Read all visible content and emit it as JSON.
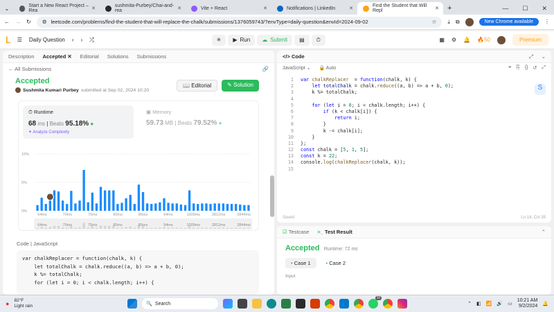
{
  "browser": {
    "tabs": [
      {
        "title": "Start a New React Project – Rea",
        "color": "#555"
      },
      {
        "title": "sushmita-Purbey/Chai-and-rea",
        "color": "#24292f"
      },
      {
        "title": "Vite + React",
        "color": "#8f5bfa"
      },
      {
        "title": "Notifications | LinkedIn",
        "color": "#0a66c2"
      },
      {
        "title": "Find the Student that Will Repl",
        "color": "#ffa116"
      }
    ],
    "url": "leetcode.com/problems/find-the-student-that-will-replace-the-chalk/submissions/1376059743/?envType=daily-question&envId=2024-09-02",
    "update_label": "New Chrome available"
  },
  "lcnav": {
    "daily": "Daily Question",
    "run": "Run",
    "submit": "Submit",
    "fire_count": "50",
    "premium": "Premium"
  },
  "left": {
    "tabs": [
      "Description",
      "Accepted",
      "Editorial",
      "Solutions",
      "Submissions"
    ],
    "all_submissions": "All Submissions",
    "status": "Accepted",
    "user": "Sushmita Kumari Purbey",
    "submitted": "submitted at Sep 02, 2024 10:20",
    "editorial_btn": "Editorial",
    "solution_btn": "Solution",
    "runtime": {
      "label": "Runtime",
      "value": "68",
      "unit": "ms",
      "beats_label": "Beats",
      "beats": "95.18%",
      "analyze": "Analyze Complexity"
    },
    "memory": {
      "label": "Memory",
      "value": "59.73",
      "unit": "MB",
      "beats_label": "Beats",
      "beats": "79.52%"
    },
    "code_label": "Code",
    "lang": "JavaScript",
    "code": [
      "var chalkReplacer = function(chalk, k) {",
      "    let totalChalk = chalk.reduce((a, b) => a + b, 0);",
      "    k %= totalChalk;",
      "",
      "    for (let i = 0; i < chalk.length; i++) {"
    ]
  },
  "chart_data": {
    "type": "bar",
    "title": "",
    "yticks": [
      "10%",
      "5%",
      "0%"
    ],
    "ylim": [
      0,
      10
    ],
    "xticks": [
      "64ms",
      "70ms",
      "75ms",
      "80ms",
      "85ms",
      "94ms",
      "1009ms",
      "2812ms",
      "2844ms"
    ],
    "values": [
      1,
      2.3,
      1.2,
      2.2,
      3.6,
      3.4,
      1.8,
      1.2,
      3.5,
      1.3,
      1.8,
      7.2,
      1.5,
      3.2,
      1.3,
      4.2,
      3.6,
      3.6,
      3.6,
      1.2,
      1.4,
      2.2,
      2.8,
      1.2,
      4.6,
      3.3,
      1.3,
      1.2,
      1.3,
      1.5,
      2.2,
      1.4,
      1.3,
      1.3,
      1.1,
      1.0,
      3.6,
      1.3,
      1.2,
      1.3,
      1.3,
      1.2,
      1.3,
      1.3,
      1.3,
      1.2,
      1.2,
      1.2,
      1.1,
      1.0,
      1.0
    ],
    "highlight_index": 3,
    "minimap_labels": [
      "64ms",
      "70ms",
      "75ms",
      "80ms",
      "85ms",
      "94ms",
      "1009ms",
      "2812ms",
      "2844ms"
    ]
  },
  "right": {
    "header": "Code",
    "lang": "JavaScript",
    "mode": "Auto",
    "lines": [
      [
        [
          "kw",
          "var "
        ],
        [
          "fn",
          "chalkReplacer"
        ],
        [
          "",
          "  = "
        ],
        [
          "kw",
          "function"
        ],
        [
          "",
          "(chalk, k) {"
        ]
      ],
      [
        [
          "",
          "    "
        ],
        [
          "kw",
          "let "
        ],
        [
          "var",
          "totalChalk"
        ],
        [
          "",
          " = chalk."
        ],
        [
          "fn",
          "reduce"
        ],
        [
          "",
          "((a, b) => a + b, "
        ],
        [
          "num",
          "0"
        ],
        [
          "",
          ");"
        ]
      ],
      [
        [
          "",
          "    k %= totalChalk;"
        ]
      ],
      [
        [
          "",
          ""
        ]
      ],
      [
        [
          "",
          "    "
        ],
        [
          "kw",
          "for "
        ],
        [
          "",
          "("
        ],
        [
          "kw",
          "let "
        ],
        [
          "",
          "i = "
        ],
        [
          "num",
          "0"
        ],
        [
          "",
          "; i < chalk.length; i++) {"
        ]
      ],
      [
        [
          "",
          "        "
        ],
        [
          "kw",
          "if "
        ],
        [
          "",
          "(k < chalk[i]) {"
        ]
      ],
      [
        [
          "",
          "            "
        ],
        [
          "kw",
          "return "
        ],
        [
          "",
          "i;"
        ]
      ],
      [
        [
          "",
          "        }"
        ]
      ],
      [
        [
          "",
          "        k -= chalk[i];"
        ]
      ],
      [
        [
          "",
          "    }"
        ]
      ],
      [
        [
          "",
          "};"
        ]
      ],
      [
        [
          "kw",
          "const "
        ],
        [
          "",
          "chalk = ["
        ],
        [
          "num",
          "5"
        ],
        [
          ",",
          ", "
        ],
        [
          "num",
          "1"
        ],
        [
          "",
          ", "
        ],
        [
          "num",
          "5"
        ],
        [
          "",
          "];"
        ]
      ],
      [
        [
          "kw",
          "const "
        ],
        [
          "",
          "k = "
        ],
        [
          "num",
          "22"
        ],
        [
          "",
          ";"
        ]
      ],
      [
        [
          "",
          "console."
        ],
        [
          "fn",
          "log"
        ],
        [
          "",
          "("
        ],
        [
          "fn",
          "chalkReplacer"
        ],
        [
          "",
          "(chalk, k));"
        ]
      ],
      [
        [
          "",
          ""
        ]
      ]
    ],
    "saved": "Saved",
    "cursor": "Ln 14, Col 39",
    "test_tabs": [
      "Testcase",
      "Test Result"
    ],
    "result": "Accepted",
    "runtime": "Runtime: 72 ms",
    "cases": [
      "Case 1",
      "Case 2"
    ],
    "input_label": "Input"
  },
  "taskbar": {
    "weather_temp": "82°F",
    "weather_desc": "Light rain",
    "search": "Search",
    "time": "10:21 AM",
    "date": "9/2/2024",
    "badge": "10"
  }
}
